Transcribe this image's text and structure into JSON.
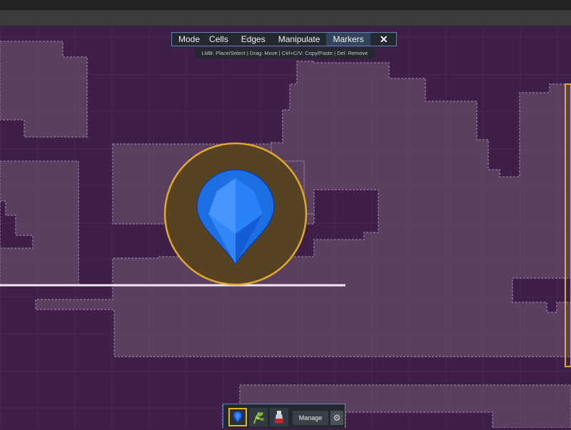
{
  "toolbar": {
    "mode_label": "Mode",
    "items": [
      {
        "label": "Cells",
        "active": false
      },
      {
        "label": "Edges",
        "active": false
      },
      {
        "label": "Manipulate",
        "active": false
      },
      {
        "label": "Markers",
        "active": true
      }
    ],
    "close_symbol": "✕"
  },
  "hint": "LMB: Place/Select | Drag: Move | Ctrl+C/V: Copy/Paste | Del: Remove",
  "marker": {
    "icon": "blue-gem-icon",
    "selected": true,
    "ring_color": "#e0aa2c",
    "fill_color": "#574221"
  },
  "bottom_bar": {
    "marker_types": [
      {
        "icon": "blue-gem-icon",
        "selected": true
      },
      {
        "icon": "green-plant-icon",
        "selected": false
      },
      {
        "icon": "red-potion-icon",
        "selected": false
      }
    ],
    "manage_label": "Manage",
    "settings_icon": "gear-icon"
  },
  "colors": {
    "room_fill": "#5b3f5f",
    "wall_fill": "#3d1f48",
    "edge": "#7a5a84",
    "accent": "#5d86b7",
    "highlight": "#e3b320"
  }
}
